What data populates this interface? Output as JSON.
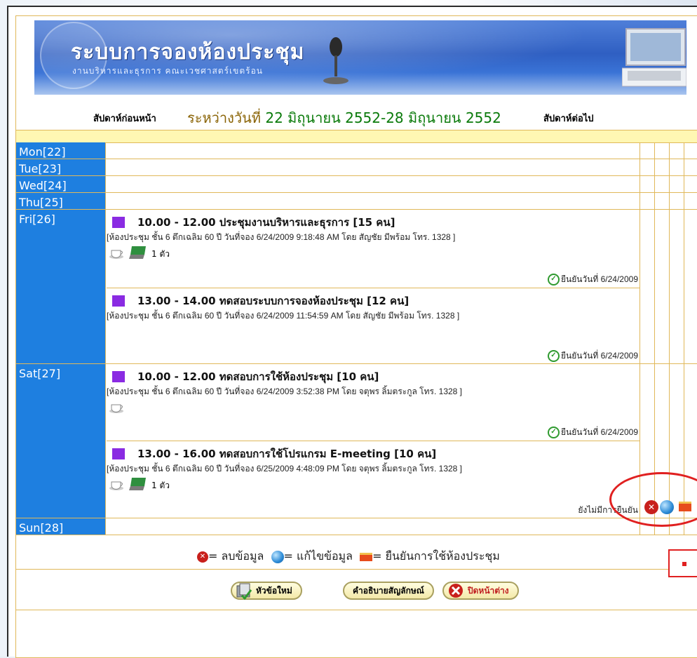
{
  "banner": {
    "title": "ระบบการจองห้องประชุม",
    "subtitle": "งานบริหารและธุรการ คณะเวชศาสตร์เขตร้อน"
  },
  "week_nav": {
    "prev_label": "สัปดาห์ก่อนหน้า",
    "range_label": "ระหว่างวันที่",
    "range_value": "22 มิถุนายน 2552-28 มิถุนายน 2552",
    "next_label": "สัปดาห์ต่อไป"
  },
  "days": [
    {
      "label": "Mon[22]"
    },
    {
      "label": "Tue[23]"
    },
    {
      "label": "Wed[24]"
    },
    {
      "label": "Thu[25]"
    },
    {
      "label": "Fri[26]"
    },
    {
      "label": "Sat[27]"
    },
    {
      "label": "Sun[28]"
    }
  ],
  "bookings": [
    {
      "title": "10.00 - 12.00 ประชุมงานบริหารและธุรการ [15 คน]",
      "detail": "[ห้องประชุม ชั้น 6 ตึกเฉลิม 60 ปี วันที่จอง 6/24/2009 9:18:48 AM โดย สัญชัย มีพร้อม โทร. 1328 ]",
      "qty": "1 ตัว",
      "status": "ยืนยันวันที่ 6/24/2009"
    },
    {
      "title": "13.00 - 14.00 ทดสอบระบบการจองห้องประชุม [12 คน]",
      "detail": "[ห้องประชุม ชั้น 6 ตึกเฉลิม 60 ปี วันที่จอง 6/24/2009 11:54:59 AM โดย สัญชัย มีพร้อม โทร. 1328 ]",
      "status": "ยืนยันวันที่ 6/24/2009"
    },
    {
      "title": "10.00 - 12.00 ทดสอบการใช้ห้องประชุม [10 คน]",
      "detail": "[ห้องประชุม ชั้น 6 ตึกเฉลิม 60 ปี วันที่จอง 6/24/2009 3:52:38 PM โดย จตุพร ลิ้มตระกูล โทร. 1328 ]",
      "status": "ยืนยันวันที่ 6/24/2009"
    },
    {
      "title": "13.00 - 16.00 ทดสอบการใช้โปรแกรม E-meeting [10 คน]",
      "detail": "[ห้องประชุม ชั้น 6 ตึกเฉลิม 60 ปี วันที่จอง 6/25/2009 4:48:09 PM โดย จตุพร ลิ้มตระกูล โทร. 1328 ]",
      "qty": "1 ตัว",
      "status": "ยังไม่มีการยืนยัน"
    }
  ],
  "legend": {
    "delete": "= ลบข้อมูล",
    "edit": "= แก้ไขข้อมูล",
    "confirm": "= ยืนยันการใช้ห้องประชุม"
  },
  "buttons": {
    "new_topic": "หัวข้อใหม่",
    "symbols": "คำอธิบายสัญลักษณ์",
    "close": "ปิดหน้าต่าง"
  },
  "colors": {
    "day_bg": "#1e7fe0",
    "booking_marker": "#8a2be2",
    "border": "#e0b85a",
    "range_text": "#0a7a0a",
    "highlight": "#e02020"
  }
}
